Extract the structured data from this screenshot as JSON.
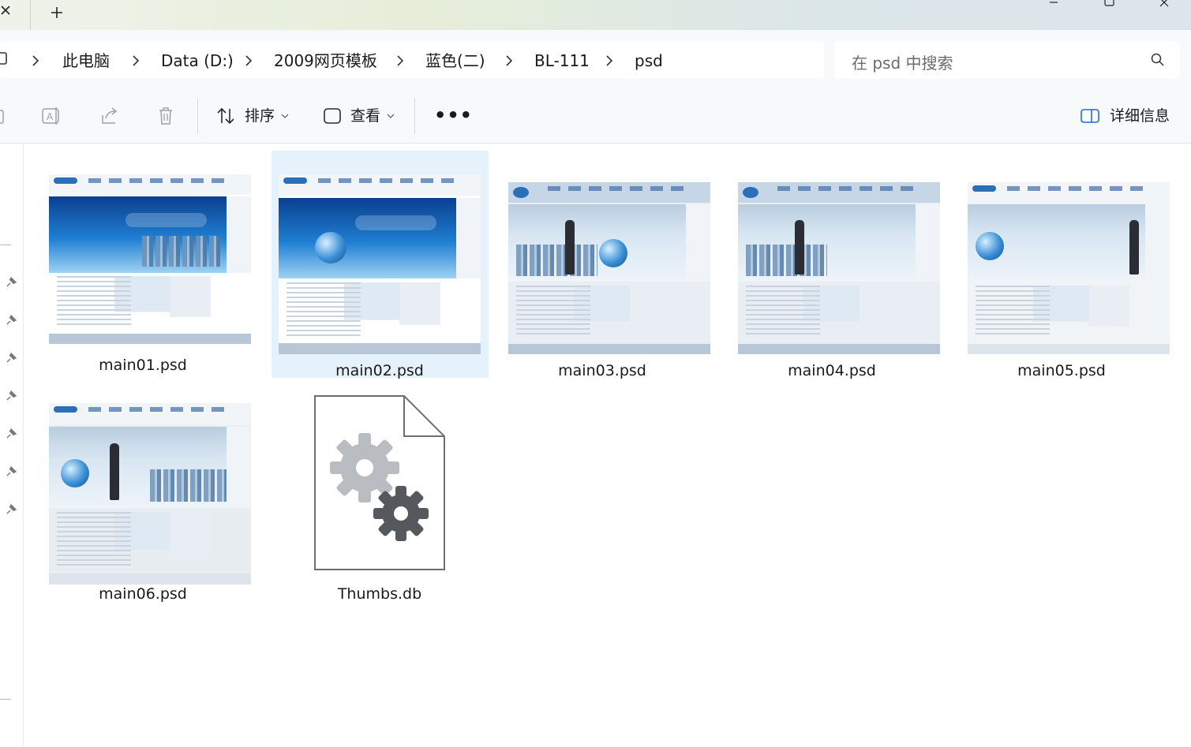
{
  "titlebar": {
    "new_tab_glyph": "+",
    "close_tab_glyph": "×"
  },
  "address": {
    "crumbs": [
      "此电脑",
      "Data (D:)",
      "2009网页模板",
      "蓝色(二)",
      "BL-111",
      "psd"
    ]
  },
  "search": {
    "placeholder": "在 psd 中搜索"
  },
  "commandbar": {
    "sort_label": "排序",
    "view_label": "查看",
    "more_label": "•••",
    "details_label": "详细信息"
  },
  "files": [
    {
      "name": "main01.psd",
      "style": "dark-hero",
      "selected": false
    },
    {
      "name": "main02.psd",
      "style": "dark-hero",
      "selected": true
    },
    {
      "name": "main03.psd",
      "style": "light-hero",
      "selected": false
    },
    {
      "name": "main04.psd",
      "style": "light-hero",
      "selected": false
    },
    {
      "name": "main05.psd",
      "style": "light-hero",
      "selected": false
    },
    {
      "name": "main06.psd",
      "style": "light-hero",
      "selected": false
    },
    {
      "name": "Thumbs.db",
      "style": "system-file",
      "selected": false
    }
  ],
  "colors": {
    "selection": "#e5f1fb",
    "commandbar_bg": "#f7f9fa",
    "accent": "#1f6fc5"
  }
}
